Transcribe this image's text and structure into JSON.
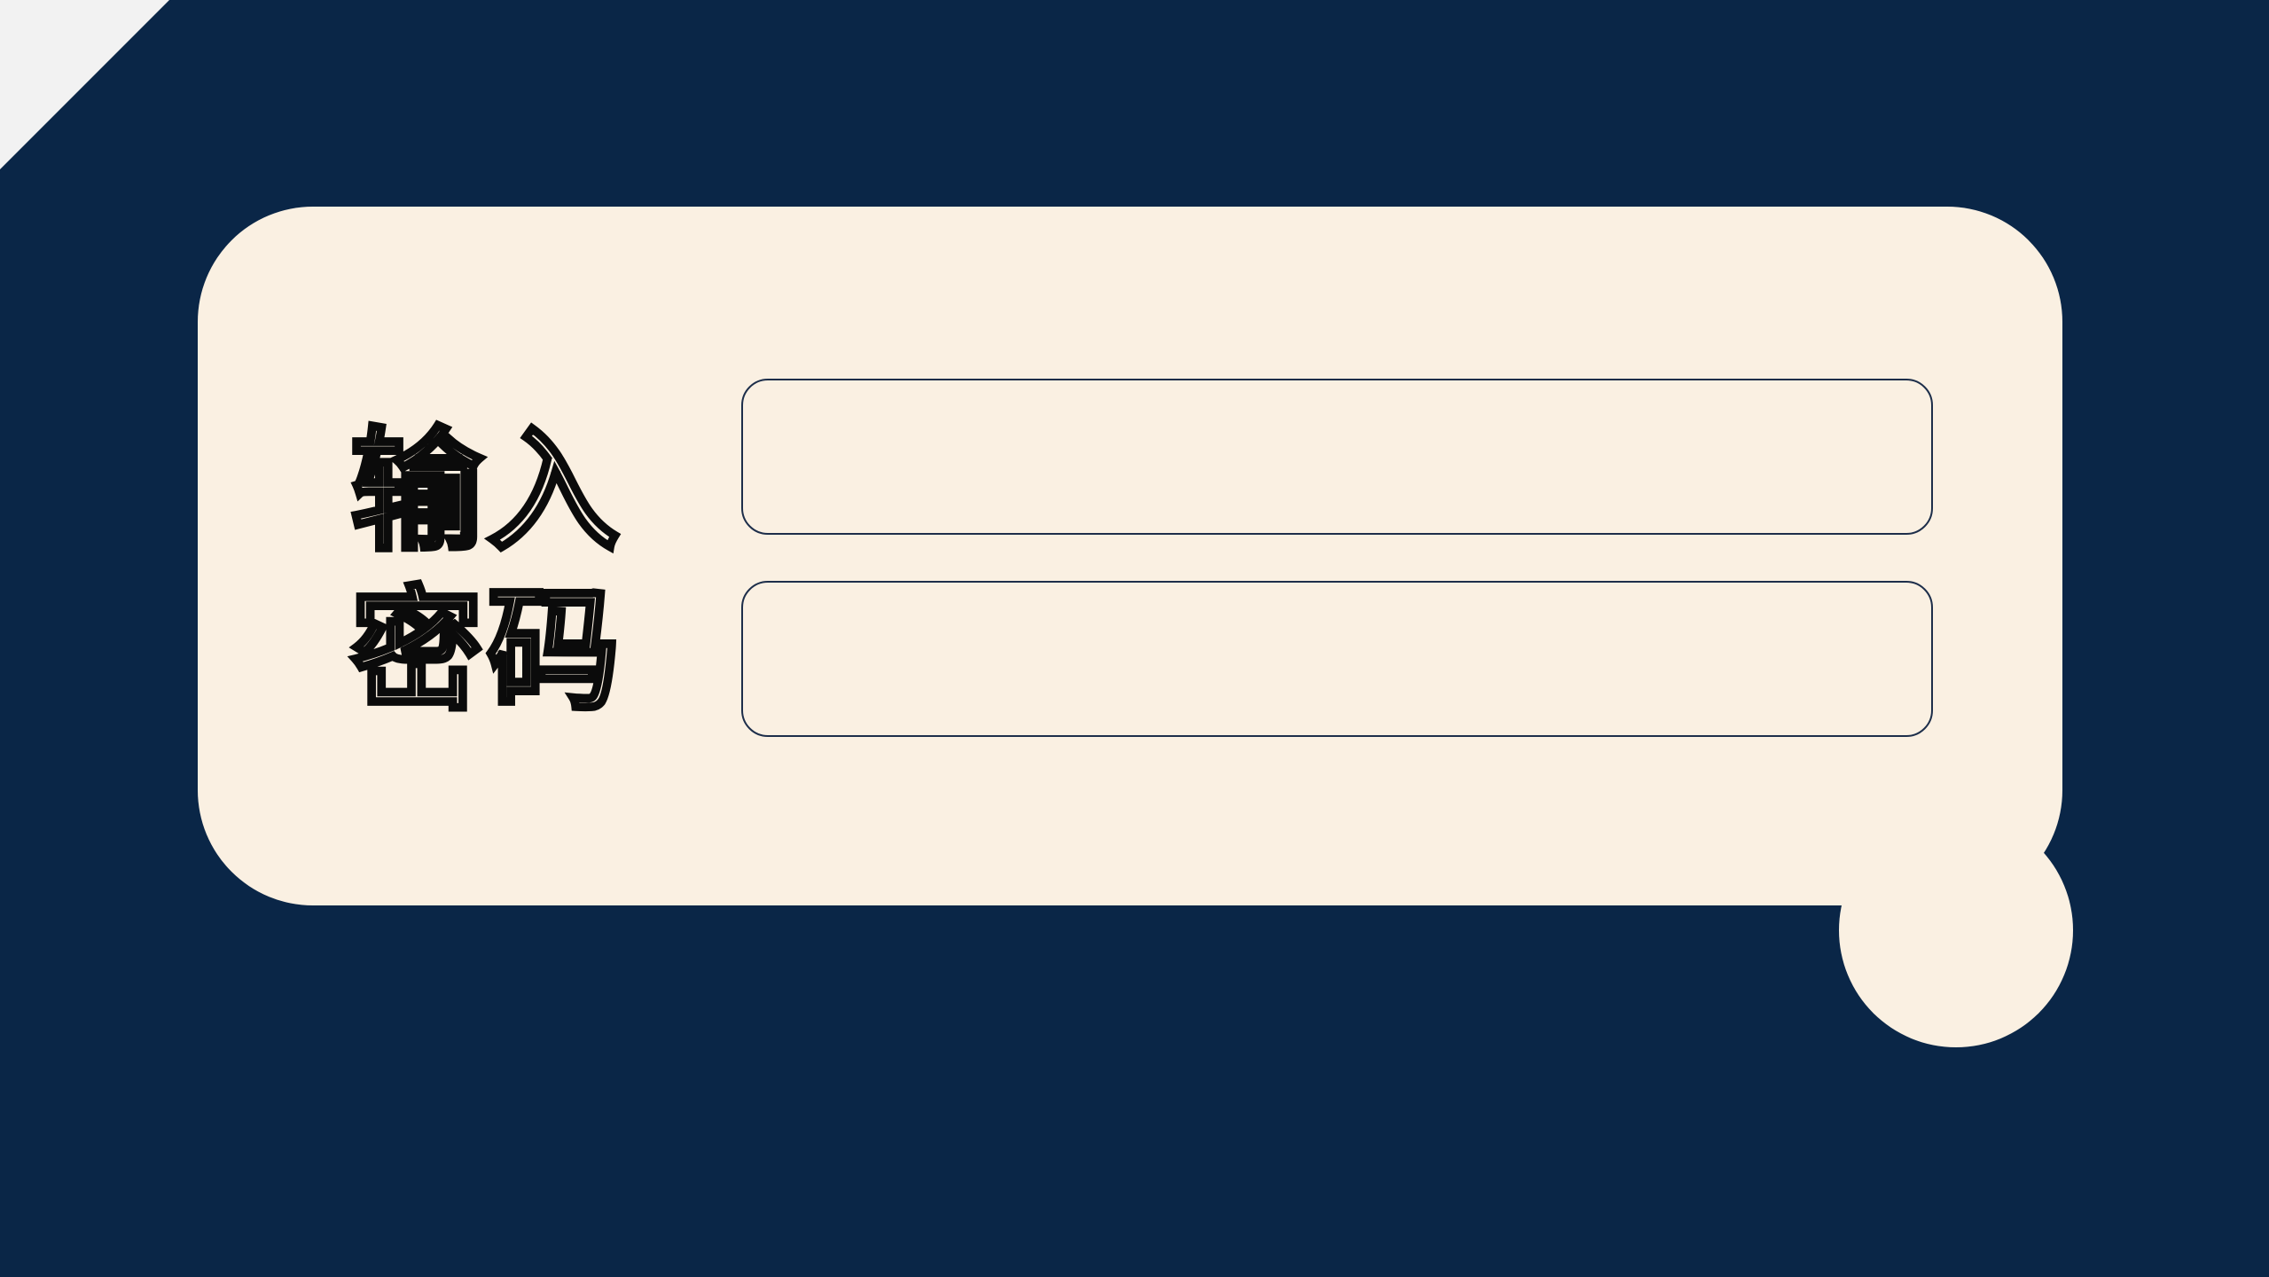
{
  "form": {
    "label_line_1": "输入",
    "label_line_2": "密码",
    "field_1": {
      "value": "",
      "placeholder": ""
    },
    "field_2": {
      "value": "",
      "placeholder": ""
    }
  },
  "colors": {
    "background": "#0a2647",
    "card": "#faf0e2",
    "corner": "#f2f2f2",
    "field_border": "#1d2e4a",
    "label_outline": "#0b0b0b"
  }
}
